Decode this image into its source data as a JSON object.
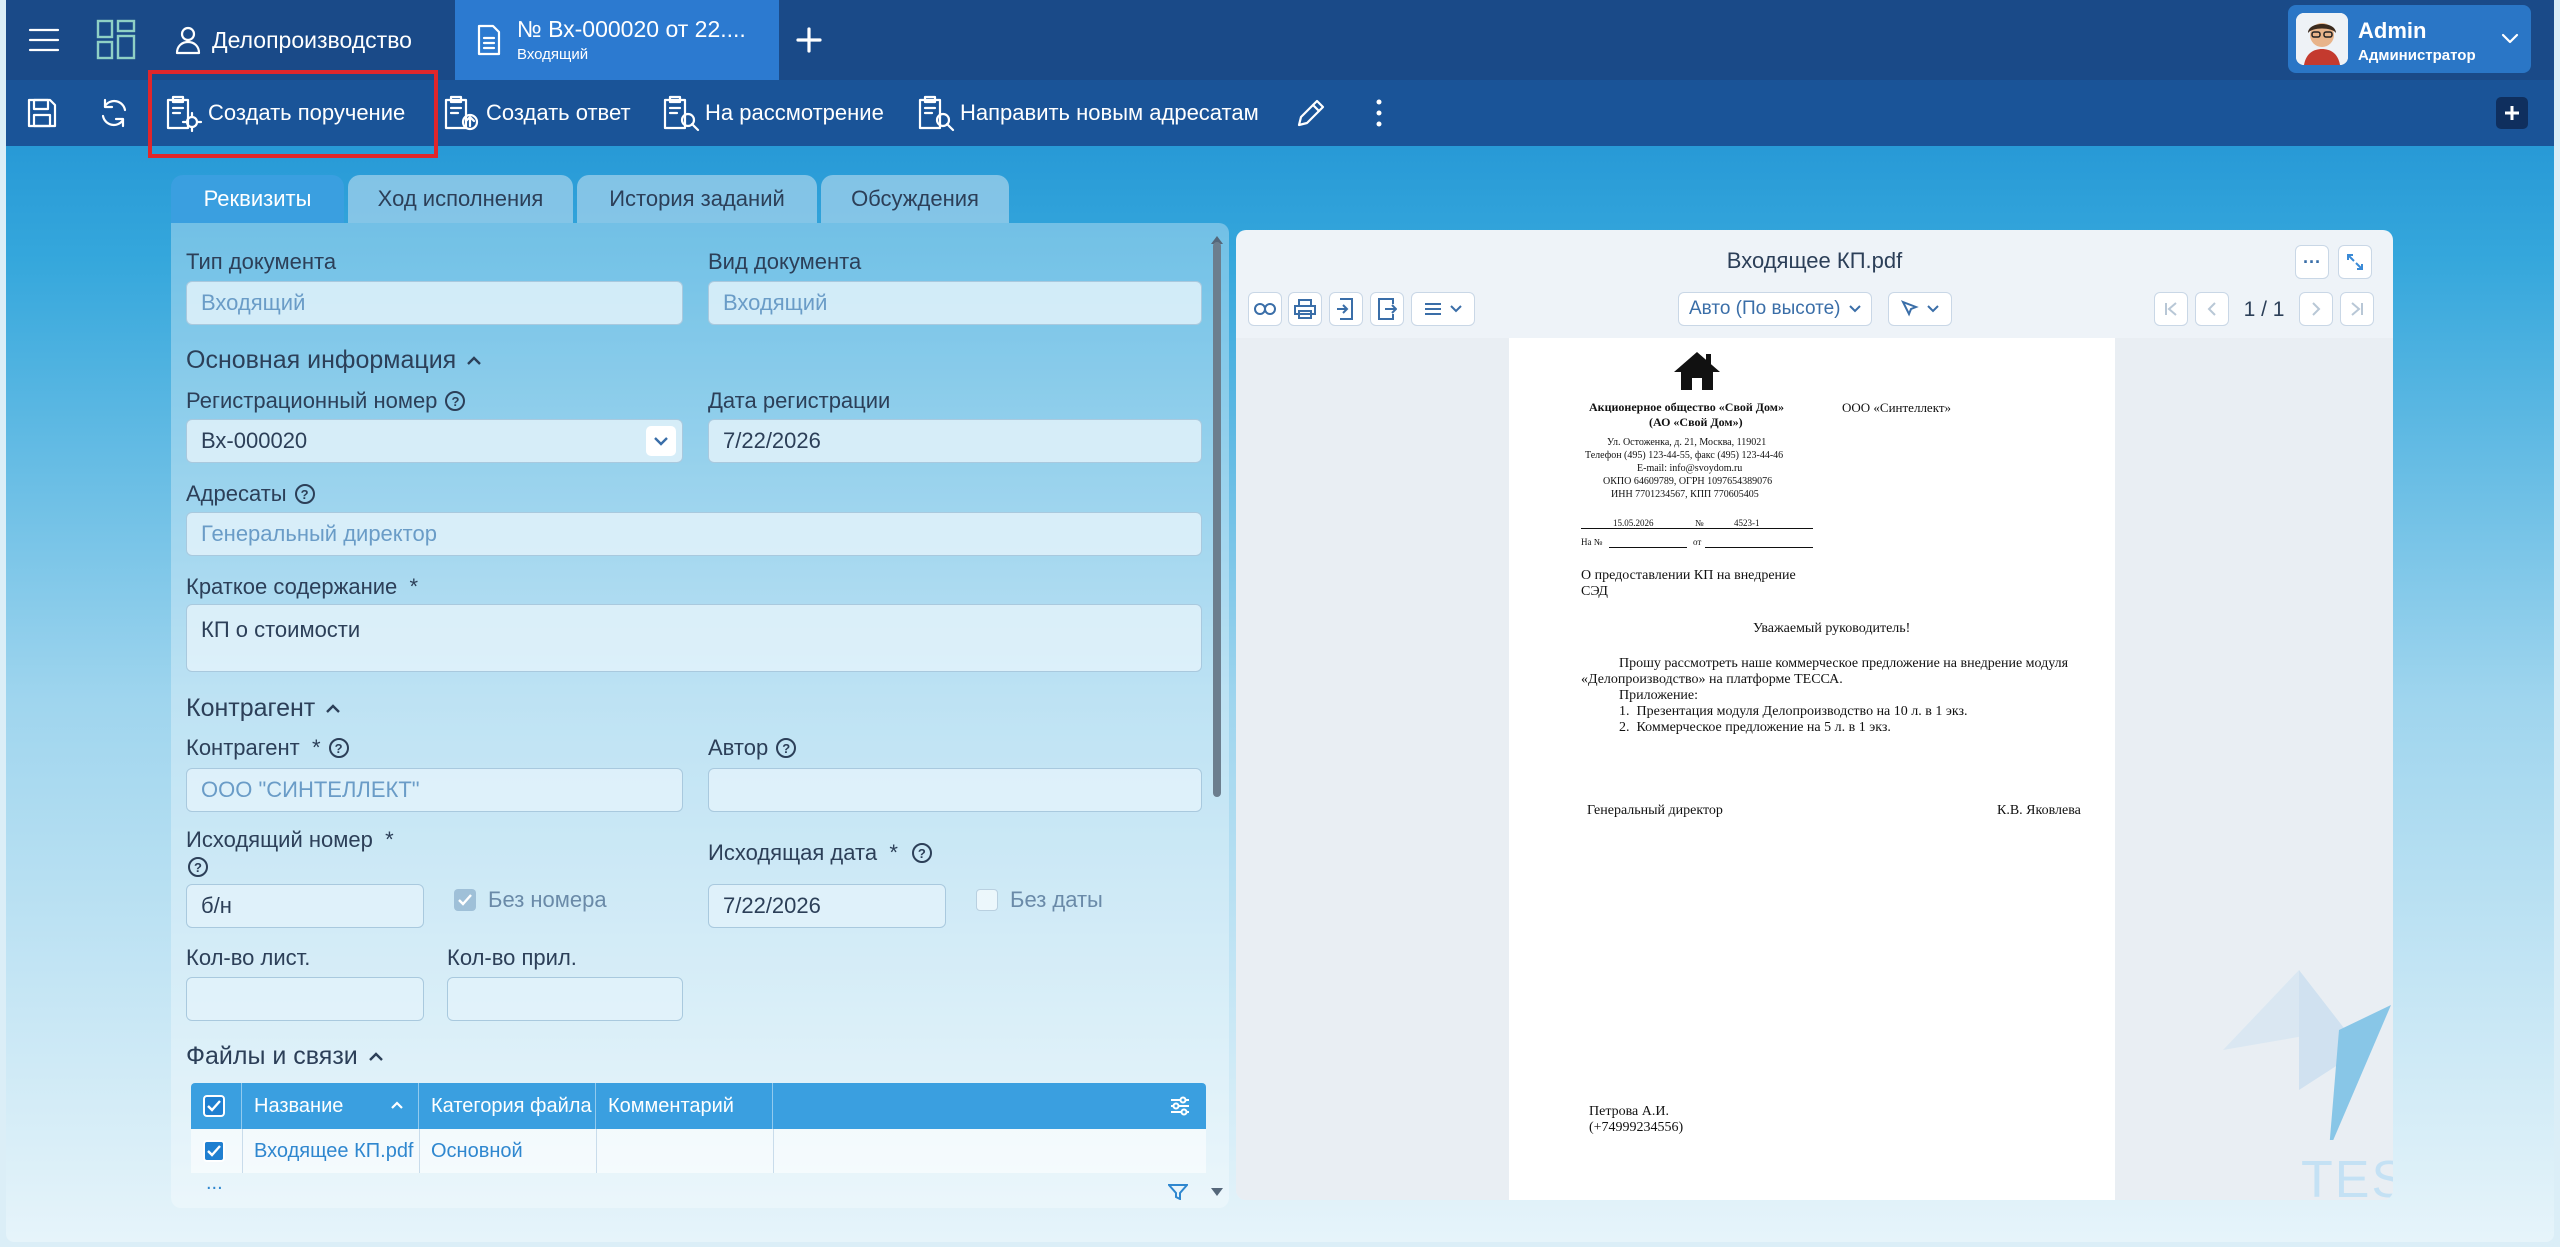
{
  "header": {
    "app_title": "Делопроизводство",
    "doc_tab": {
      "title": "№ Вх-000020 от 22....",
      "subtitle": "Входящий"
    },
    "user": {
      "name": "Admin",
      "role": "Администратор"
    }
  },
  "toolbar": {
    "create_task": "Создать поручение",
    "create_reply": "Создать ответ",
    "to_review": "На рассмотрение",
    "send_new": "Направить новым адресатам"
  },
  "tabs": [
    "Реквизиты",
    "Ход исполнения",
    "История заданий",
    "Обсуждения"
  ],
  "form": {
    "doc_type_label": "Тип документа",
    "doc_type_value": "Входящий",
    "doc_kind_label": "Вид документа",
    "doc_kind_value": "Входящий",
    "main_info_title": "Основная информация",
    "reg_number_label": "Регистрационный номер",
    "reg_number_value": "Вх-000020",
    "reg_date_label": "Дата регистрации",
    "reg_date_value": "7/22/2026",
    "addressees_label": "Адресаты",
    "addressees_value": "Генеральный директор",
    "summary_label": "Краткое содержание",
    "summary_value": "КП о стоимости",
    "counterparty_section": "Контрагент",
    "counterparty_label": "Контрагент",
    "counterparty_value": "ООО \"СИНТЕЛЛЕКТ\"",
    "author_label": "Автор",
    "out_number_label": "Исходящий номер",
    "out_number_value": "б/н",
    "no_number_label": "Без номера",
    "out_date_label": "Исходящая дата",
    "out_date_value": "7/22/2026",
    "no_date_label": "Без даты",
    "sheets_label": "Кол-во лист.",
    "attachments_label": "Кол-во прил.",
    "files_section": "Файлы и связи",
    "required_mark": "*"
  },
  "files_table": {
    "columns": [
      "Название",
      "Категория файла",
      "Комментарий"
    ],
    "rows": [
      {
        "name": "Входящее КП.pdf",
        "category": "Основной",
        "comment": ""
      }
    ],
    "more": "..."
  },
  "preview": {
    "title": "Входящее КП.pdf",
    "scale": "Авто (По высоте)",
    "page_info": "1 / 1",
    "more": "···"
  },
  "pdf": {
    "org_name_1": "Акционерное общество «Свой Дом»",
    "org_name_2": "(АО «Свой Дом»)",
    "recipient": "ООО «Синтеллект»",
    "addr_1": "Ул. Остоженка, д. 21, Москва, 119021",
    "addr_2": "Телефон (495) 123-44-55, факс (495) 123-44-46",
    "addr_3": "E-mail: info@svoydom.ru",
    "addr_4": "ОКПО 64609789, ОГРН 1097654389076",
    "addr_5": "ИНН 7701234567, КПП 770605405",
    "date": "15.05.2026",
    "num_label": "№",
    "num": "4523-1",
    "ref_label": "На №",
    "ref_from": "от",
    "subject_1": "О предоставлении КП на внедрение",
    "subject_2": "СЭД",
    "greeting": "Уважаемый руководитель!",
    "body_1": "Прошу рассмотреть наше коммерческое предложение на внедрение модуля",
    "body_2": "«Делопроизводство» на платформе ТЕССА.",
    "attach_label": "Приложение:",
    "attach_1": "1.  Презентация модуля Делопроизводство на 10 л. в 1 экз.",
    "attach_2": "2.  Коммерческое предложение на 5 л. в 1 экз.",
    "signer_title": "Генеральный директор",
    "signer_name": "К.В. Яковлева",
    "executor_name": "Петрова А.И.",
    "executor_phone": "(+74999234556)"
  },
  "watermark": "TESSA",
  "colors": {
    "topbar": "#1a4a88",
    "toolbar": "#1a5498",
    "accent": "#3a9fe0",
    "highlight": "#e0262b"
  }
}
